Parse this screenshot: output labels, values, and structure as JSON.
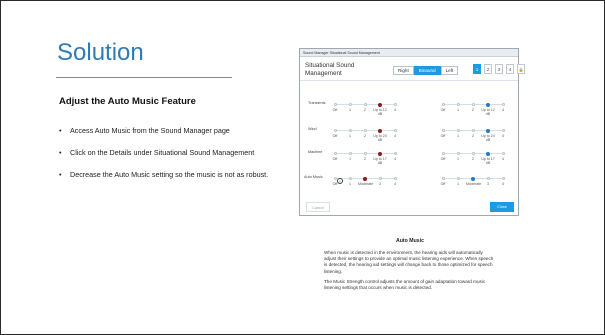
{
  "slide": {
    "title": "Solution",
    "subheading": "Adjust the Auto Music Feature",
    "bullets": [
      "Access Auto Music from the Sound Manager page",
      "Click on the Details under Situational Sound Management",
      "Decrease the Auto Music setting so the music is not as robust."
    ],
    "bullet_char": "•"
  },
  "dialog": {
    "titlebar": "Sound Manager Situational Sound Management",
    "header": "Situational Sound Management",
    "segments": [
      {
        "label": "Right",
        "active": false
      },
      {
        "label": "Binaural",
        "active": true
      },
      {
        "label": "Left",
        "active": false
      }
    ],
    "programs": [
      {
        "label": "1",
        "active": true
      },
      {
        "label": "2",
        "active": false
      },
      {
        "label": "3",
        "active": false
      },
      {
        "label": "4",
        "active": false
      },
      {
        "label": "🔒",
        "active": false
      }
    ],
    "rows": [
      {
        "label": "Transients",
        "left": {
          "ticks": [
            "Off",
            "1",
            "2",
            "Up to 12 dB",
            "4"
          ],
          "selected": 3,
          "color": "red"
        },
        "right": {
          "ticks": [
            "Off",
            "1",
            "2",
            "Up to 12 dB",
            "4"
          ],
          "selected": 3,
          "color": "blue"
        }
      },
      {
        "label": "Wind",
        "left": {
          "ticks": [
            "Off",
            "1",
            "2",
            "Up to 24 dB",
            "4"
          ],
          "selected": 3,
          "color": "red"
        },
        "right": {
          "ticks": [
            "Off",
            "1",
            "2",
            "Up to 24 dB",
            "4"
          ],
          "selected": 3,
          "color": "blue"
        }
      },
      {
        "label": "Machine",
        "left": {
          "ticks": [
            "Off",
            "1",
            "2",
            "Up to 17 dB",
            "4"
          ],
          "selected": 3,
          "color": "red"
        },
        "right": {
          "ticks": [
            "Off",
            "1",
            "2",
            "Up to 17 dB",
            "4"
          ],
          "selected": 3,
          "color": "blue"
        }
      },
      {
        "label": "Auto Music",
        "left": {
          "ticks": [
            "Off",
            "1",
            "Moderate",
            "3",
            "4"
          ],
          "selected": 2,
          "color": "red"
        },
        "right": {
          "ticks": [
            "Off",
            "1",
            "Moderate",
            "3",
            "4"
          ],
          "selected": 2,
          "color": "blue"
        }
      }
    ],
    "info_glyph": "i",
    "cancel_label": "Cancel",
    "close_label": "Close",
    "accent_color": "#1e9be0",
    "left_ear_color": "#8b1a1a",
    "right_ear_color": "#1e7cc8"
  },
  "caption": {
    "title": "Auto Music",
    "paragraphs": [
      "When music is detected in the environment, the hearing aids will automatically adjust their settings to provide an optimal music listening experience.  When speech is detected, the hearing aid settings will change back to those optimized for speech listening.",
      "The Music Strength control adjusts the amount of gain adaptation toward music listening settings that occurs when music is detected."
    ]
  }
}
